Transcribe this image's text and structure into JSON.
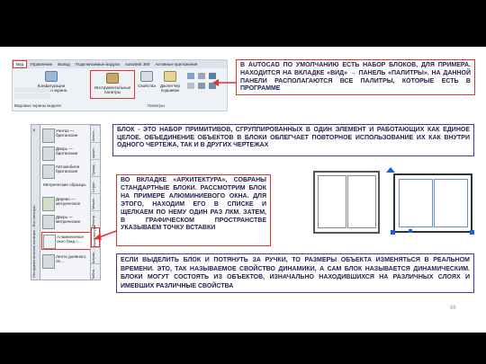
{
  "ribbon": {
    "tabs": [
      "Вид",
      "Управление",
      "Вывод",
      "Подключаемые модули",
      "Autodesk 360",
      "Активные приложения"
    ],
    "buttons": [
      {
        "label": "Конфигурации видового экрана",
        "icon": "viewport-config-icon"
      },
      {
        "label": "Инструментальные палитры",
        "icon": "tool-palettes-icon"
      },
      {
        "label": "Свойства",
        "icon": "properties-icon"
      },
      {
        "label": "Диспетчер подшивок",
        "icon": "sheet-set-manager-icon"
      }
    ],
    "panel_label": "Палитры",
    "left_panel_label": "Видовые экраны модели"
  },
  "texts": {
    "top": "В AUTOCAD ПО УМОЛЧАНИЮ ЕСТЬ НАБОР БЛОКОВ, ДЛЯ ПРИМЕРА. НАХОДИТСЯ НА ВКЛАДКЕ «ВИД» → ПАНЕЛЬ «ПАЛИТРЫ». НА ДАННОЙ ПАНЕЛИ РАСПОЛАГАЮТСЯ ВСЕ ПАЛИТРЫ, КОТОРЫЕ ЕСТЬ В ПРОГРАММЕ",
    "block": "БЛОК - ЭТО НАБОР ПРИМИТИВОВ, СГРУППИРОВАННЫХ В ОДИН ЭЛЕМЕНТ И РАБОТАЮЩИХ КАК ЕДИНОЕ ЦЕЛОЕ. ОБЪЕДИНЕНИЕ ОБЪЕКТОВ В БЛОКИ ОБЛЕГЧАЕТ ПОВТОРНОЕ ИСПОЛЬЗОВАНИЕ ИХ КАК ВНУТРИ ОДНОГО ЧЕРТЕЖА, ТАК И В ДРУГИХ ЧЕРТЕЖАХ",
    "arch": "ВО ВКЛАДКЕ «АРХИТЕКТУРА», СОБРАНЫ СТАНДАРТНЫЕ БЛОКИ. РАССМОТРИМ БЛОК НА ПРИМЕРЕ АЛЮМИНИЕВОГО ОКНА. ДЛЯ ЭТОГО, НАХОДИМ ЕГО В СПИСКЕ И ЩЕЛКАЕМ ПО НЕМУ ОДИН РАЗ ЛКМ. ЗАТЕМ, В ГРАФИЧЕСКОМ ПРОСТРАНСТВЕ УКАЗЫВАЕМ ТОЧКУ ВСТАВКИ",
    "dynamic": "ЕСЛИ ВЫДЕЛИТЬ БЛОК И ПОТЯНУТЬ ЗА РУЧКИ, ТО РАЗМЕРЫ ОБЪЕКТА ИЗМЕНЯТЬСЯ В РЕАЛЬНОМ ВРЕМЕНИ. ЭТО, ТАК НАЗЫВАЕМОЕ СВОЙСТВО ДИНАМИКИ, А САМ БЛОК НАЗЫВАЕТСЯ ДИНАМИЧЕСКИМ. БЛОКИ МОГУТ СОСТОЯТЬ ИЗ ОБЪЕКТОВ, ИЗНАЧАЛЬНО НАХОДИВШИХСЯ НА РАЗЛИЧНЫХ СЛОЯХ И ИМЕВШИХ РАЗЛИЧНЫЕ СВОЙСТВА"
  },
  "palette": {
    "items": [
      "Унитаз — британские",
      "Дверь — британские",
      "Автомобили британские",
      "Метрические образцы",
      "Дерево — метрическое",
      "Дверь — метрические",
      "Алюминиевое окно (вид с…",
      "Лента дневного св…"
    ],
    "tabs": [
      "Аннот…",
      "Архит…",
      "Гражд…",
      "Струк…",
      "Механ…",
      "Электр…",
      "Архитектура",
      "Штрих…",
      "Табли…"
    ],
    "side_title": "Инструментальные палитры - Все палитры"
  },
  "page_number": "66",
  "colors": {
    "accent": "#e2332b",
    "text": "#1f1f4f",
    "border": "#3c3c9c",
    "handle": "#1d5fd0"
  }
}
